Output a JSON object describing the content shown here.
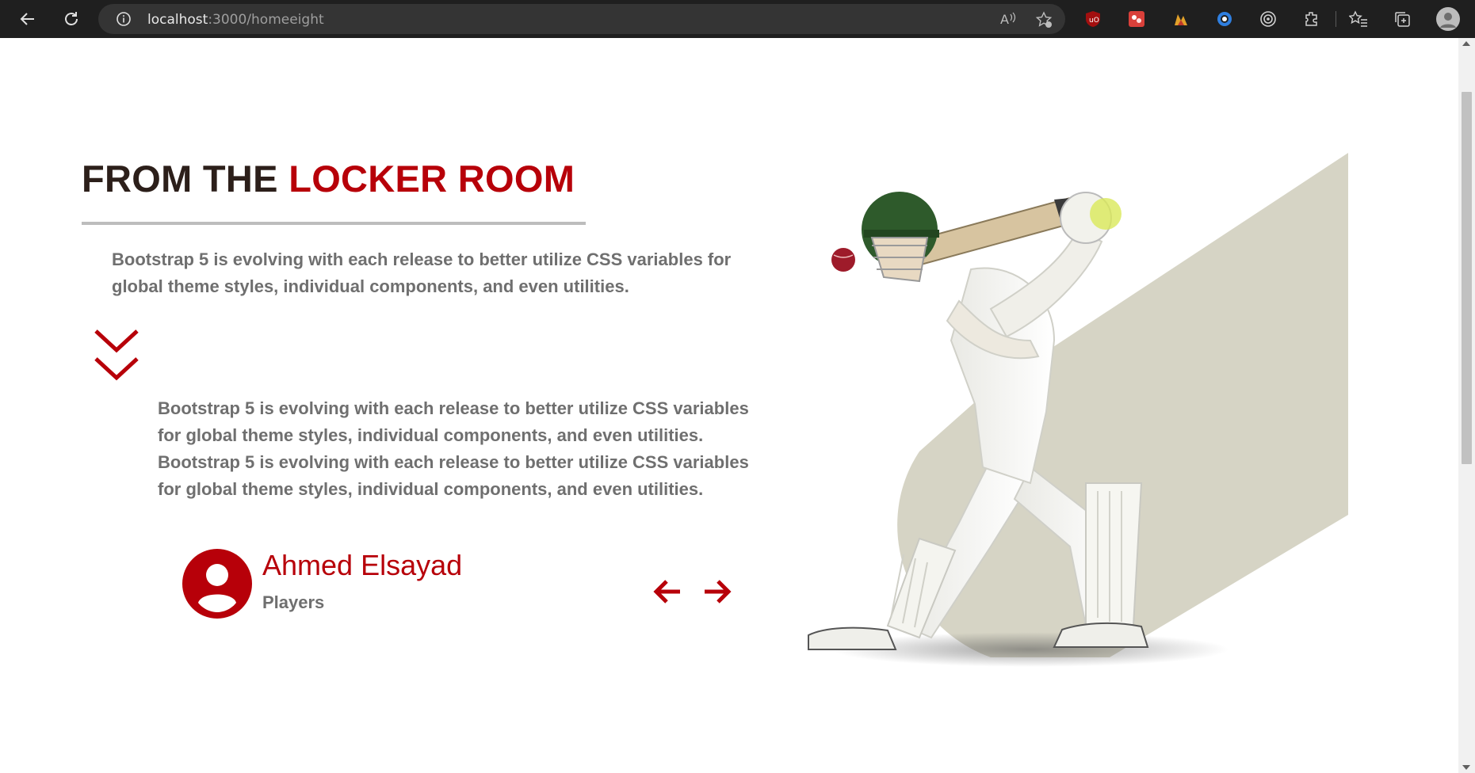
{
  "browser": {
    "url_host": "localhost",
    "url_path": ":3000/homeeight",
    "icons": {
      "back": "back-arrow-icon",
      "reload": "reload-icon",
      "info": "info-icon",
      "read_aloud": "read-aloud-icon",
      "favorite": "add-favorite-icon",
      "extensions": "extensions-icon",
      "favorites": "favorites-icon",
      "collections": "collections-icon",
      "profile": "profile-icon"
    }
  },
  "section": {
    "title_part1": "FROM THE ",
    "title_part2": "LOCKER ROOM",
    "intro": "Bootstrap 5 is evolving with each release to better utilize CSS variables for global theme styles, individual components, and even utilities.",
    "quote": "Bootstrap 5 is evolving with each release to better utilize CSS variables for global theme styles, individual components, and even utilities. Bootstrap 5 is evolving with each release to better utilize CSS variables for global theme styles, individual components, and even utilities.",
    "author_name": "Ahmed Elsayad",
    "author_role": "Players",
    "image_subject": "cricket batsman"
  },
  "colors": {
    "accent": "#b70009",
    "title_dark": "#2c1f1a",
    "body_text": "#6f6f6f",
    "hero_backdrop": "#d6d4c5"
  }
}
